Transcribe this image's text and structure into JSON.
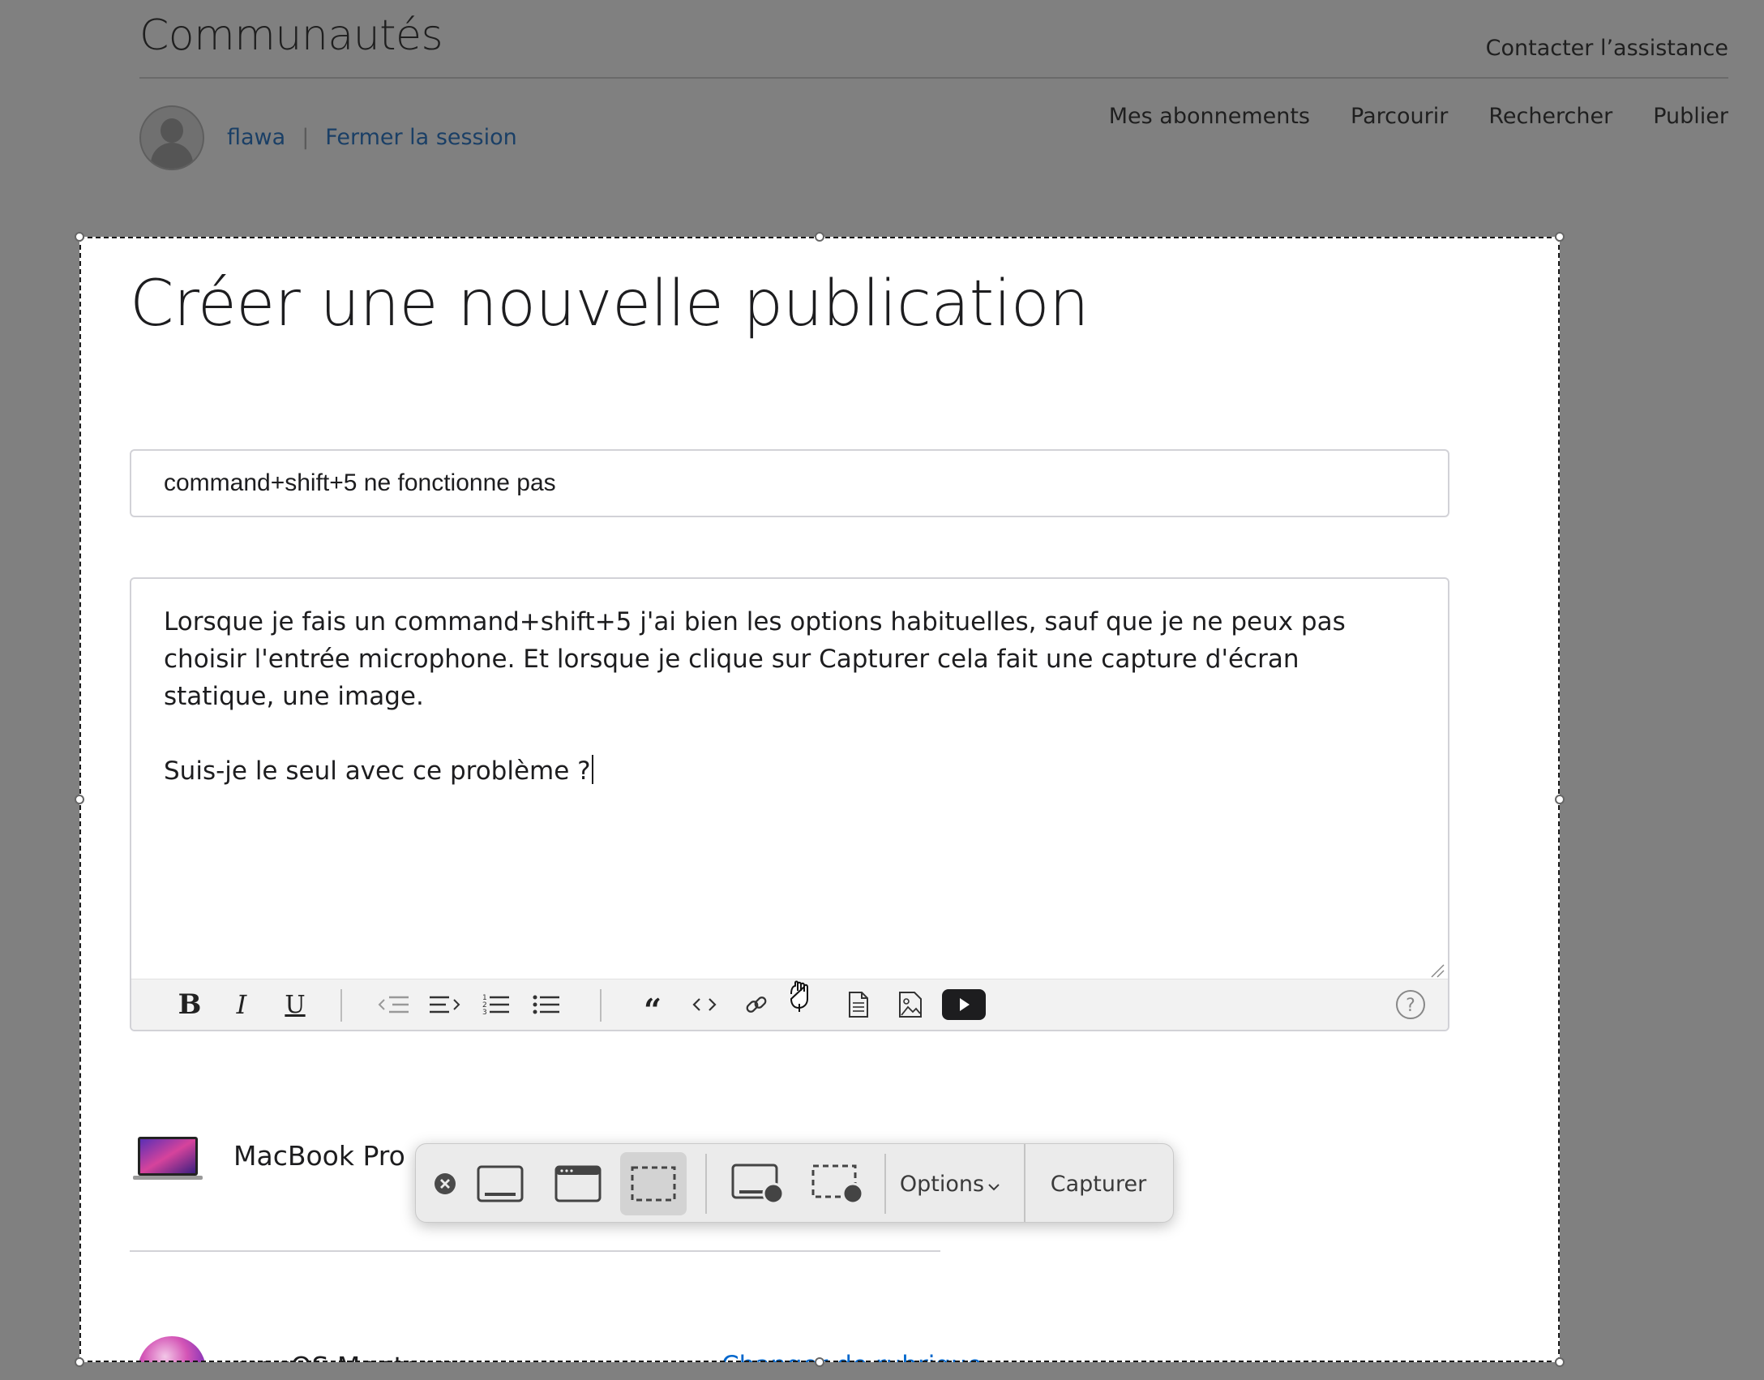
{
  "header": {
    "site_title": "Communautés",
    "support_link": "Contacter l’assistance",
    "user": {
      "name": "flawa",
      "separator": "|",
      "logout": "Fermer la session"
    },
    "nav": [
      "Mes abonnements",
      "Parcourir",
      "Rechercher",
      "Publier"
    ]
  },
  "form": {
    "heading": "Créer une nouvelle publication",
    "title_value": "command+shift+5 ne fonctionne pas",
    "body_paragraphs": [
      "Lorsque je fais un command+shift+5 j'ai bien les options habituelles, sauf que je ne peux pas choisir l'entrée microphone. Et lorsque je clique sur Capturer cela fait une capture d'écran statique, une image.",
      "Suis-je le seul avec ce problème ?"
    ],
    "toolbar_icons": [
      "bold-icon",
      "italic-icon",
      "underline-icon",
      "outdent-icon",
      "indent-icon",
      "numbered-list-icon",
      "bullet-list-icon",
      "quote-icon",
      "code-icon",
      "link-icon",
      "attach-file-icon",
      "image-icon",
      "video-icon",
      "help-icon"
    ],
    "product": {
      "label": "MacBook Pro de"
    },
    "topic": {
      "label": "macOS Monterey",
      "change_link": "Changer de rubrique"
    }
  },
  "capture_toolbar": {
    "icons": [
      "close-icon",
      "capture-entire-screen-icon",
      "capture-window-icon",
      "capture-selection-icon",
      "record-entire-screen-icon",
      "record-selection-icon"
    ],
    "active": "capture-selection-icon",
    "options_label": "Options",
    "capture_label": "Capturer"
  },
  "colors": {
    "overlay": "#808080",
    "link": "#0066cc",
    "link_dimmed": "#1a3f66",
    "video_button": "#1d1d1f"
  }
}
